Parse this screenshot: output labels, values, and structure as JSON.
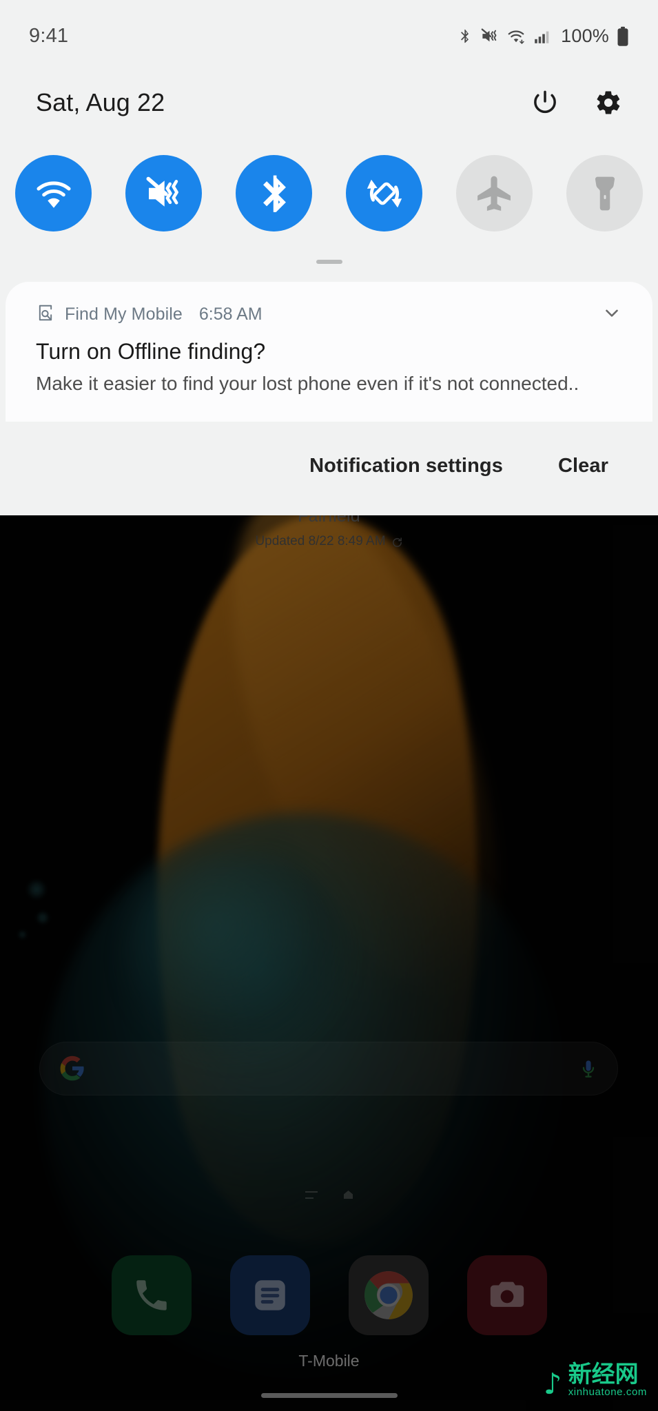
{
  "status_bar": {
    "clock": "9:41",
    "battery_percent": "100%",
    "icons": [
      "bluetooth-icon",
      "vibrate-mute-icon",
      "wifi-icon",
      "cellular-signal-icon",
      "battery-icon"
    ]
  },
  "shade": {
    "date": "Sat, Aug 22",
    "power_button_label": "power-icon",
    "settings_button_label": "gear-icon",
    "quick_settings": [
      {
        "name": "wifi",
        "label": "Wi-Fi",
        "state": "on"
      },
      {
        "name": "sound-mute",
        "label": "Mute",
        "state": "on"
      },
      {
        "name": "bluetooth",
        "label": "Bluetooth",
        "state": "on"
      },
      {
        "name": "auto-rotate",
        "label": "Auto rotate",
        "state": "on"
      },
      {
        "name": "airplane",
        "label": "Airplane mode",
        "state": "off"
      },
      {
        "name": "flashlight",
        "label": "Flashlight",
        "state": "off"
      }
    ]
  },
  "notification": {
    "app_name": "Find My Mobile",
    "time": "6:58 AM",
    "title": "Turn on Offline finding?",
    "body": "Make it easier to find your lost phone even if it's not connected..",
    "expand_icon": "chevron-down-icon"
  },
  "notification_actions": {
    "settings_label": "Notification settings",
    "clear_label": "Clear"
  },
  "home_screen": {
    "weather_city": "Fairfield",
    "weather_updated": "Updated 8/22 8:49 AM",
    "search_placeholder": "",
    "carrier": "T-Mobile",
    "dock": [
      {
        "name": "phone",
        "label": "Phone"
      },
      {
        "name": "messages",
        "label": "Messages"
      },
      {
        "name": "chrome",
        "label": "Chrome"
      },
      {
        "name": "camera",
        "label": "Camera"
      }
    ]
  },
  "watermark": {
    "glyph": "♪",
    "text": "新经网",
    "url": "xinhuatone.com"
  },
  "colors": {
    "accent_on": "#1a85eb",
    "tile_off": "#dfe0e0",
    "shade_bg": "#f1f2f2",
    "card_bg": "#fcfcfd",
    "app_name": "#6d7a86",
    "watermark": "#19c98a"
  }
}
